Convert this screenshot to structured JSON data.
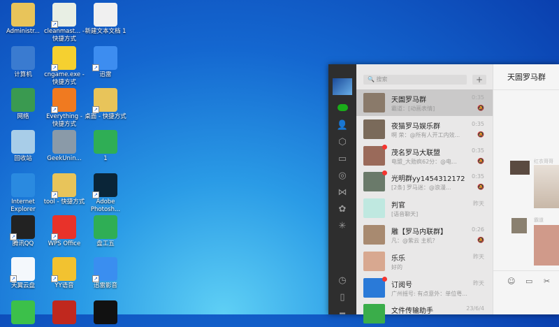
{
  "desktop": [
    {
      "label": "Administr...",
      "color": "#e8c45a",
      "sc": false
    },
    {
      "label": "cleanmast... - 快捷方式",
      "color": "#e8efe4",
      "sc": true
    },
    {
      "label": "新建文本文档 1",
      "color": "#f0f0f0",
      "sc": false
    },
    {
      "label": "计算机",
      "color": "#3a7bd0",
      "sc": false
    },
    {
      "label": "cngame.exe - 快捷方式",
      "color": "#f5d030",
      "sc": true
    },
    {
      "label": "迅雷",
      "color": "#3d8df0",
      "sc": true
    },
    {
      "label": "网络",
      "color": "#3a9a50",
      "sc": false
    },
    {
      "label": "Everything - 快捷方式",
      "color": "#f07a20",
      "sc": true
    },
    {
      "label": "桌面 - 快捷方式",
      "color": "#e8c45a",
      "sc": true
    },
    {
      "label": "回收站",
      "color": "#a8cde8",
      "sc": false
    },
    {
      "label": "GeekUnin...",
      "color": "#8a9aa8",
      "sc": false
    },
    {
      "label": "1",
      "color": "#2fae55",
      "sc": false
    },
    {
      "label": "Internet Explorer",
      "color": "#2a8ae0",
      "sc": false
    },
    {
      "label": "tool - 快捷方式",
      "color": "#e8c45a",
      "sc": true
    },
    {
      "label": "Adobe Photosh...",
      "color": "#0a2538",
      "sc": true
    },
    {
      "label": "腾讯QQ",
      "color": "#222",
      "sc": true
    },
    {
      "label": "WPS Office",
      "color": "#e8322a",
      "sc": true
    },
    {
      "label": "盘工五",
      "color": "#2fae55",
      "sc": false
    },
    {
      "label": "天翼云盘",
      "color": "#f4f8fc",
      "sc": true
    },
    {
      "label": "YY语音",
      "color": "#f2c230",
      "sc": true
    },
    {
      "label": "迅雷影音",
      "color": "#3a8ef0",
      "sc": true
    },
    {
      "label": "",
      "color": "#3cc04a",
      "sc": false
    },
    {
      "label": "",
      "color": "#c0281e",
      "sc": false
    },
    {
      "label": "",
      "color": "#111",
      "sc": false
    }
  ],
  "wechat": {
    "search_placeholder": "搜索",
    "add_label": "+",
    "chat_title": "天圄罗马群",
    "chats": [
      {
        "name": "天圄罗马群",
        "msg": "霸道：[动画表情]",
        "time": "0:35",
        "muted": true,
        "badge": false,
        "color": "#8a7a6a"
      },
      {
        "name": "夜猫罗马娱乐群",
        "msg": "啊 荣：@所有人开工内效...",
        "time": "0:35",
        "muted": true,
        "badge": false,
        "color": "#7a6a5a"
      },
      {
        "name": "茂名罗马大联盟",
        "msg": "电盟_大勋疯62分：@电...",
        "time": "0:35",
        "muted": true,
        "badge": true,
        "color": "#9a6a5a"
      },
      {
        "name": "光明群yy1454312172",
        "msg": "[2条] 罗马迷：@浪漫...",
        "time": "0:35",
        "muted": true,
        "badge": true,
        "color": "#6a7a6a"
      },
      {
        "name": "判官",
        "msg": "[语音聊天]",
        "time": "昨天",
        "muted": false,
        "badge": false,
        "color": "#bfe8e0"
      },
      {
        "name": "雕【罗马内联群】",
        "msg": "凡：@紫云 主机？",
        "time": "0:26",
        "muted": true,
        "badge": false,
        "color": "#a88a70"
      },
      {
        "name": "乐乐",
        "msg": "好的",
        "time": "昨天",
        "muted": false,
        "badge": false,
        "color": "#d8a890"
      },
      {
        "name": "订阅号",
        "msg": "广州摇号: 有点意外：单位粤...",
        "time": "昨天",
        "muted": false,
        "badge": true,
        "color": "#2a7ad8"
      },
      {
        "name": "文件传输助手",
        "msg": "",
        "time": "23/6/4",
        "muted": false,
        "badge": false,
        "color": "#3aad4a"
      }
    ],
    "messages": [
      {
        "sender": "红衣哥哥"
      },
      {
        "sender": "霸道"
      }
    ],
    "mute_icon": "bell-off-icon"
  }
}
